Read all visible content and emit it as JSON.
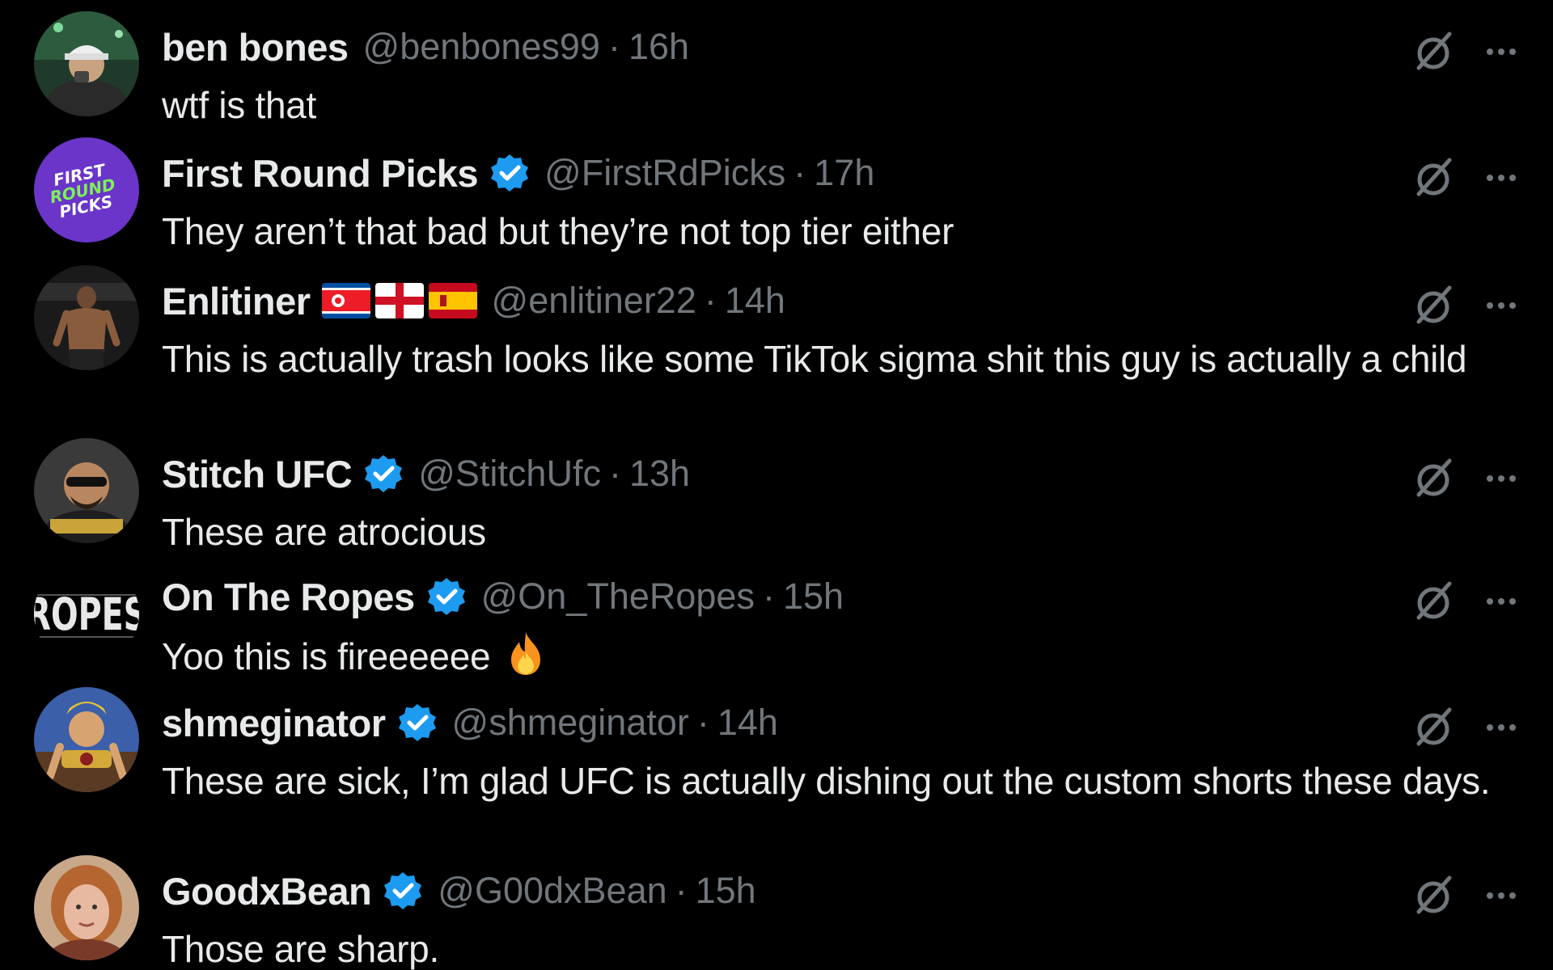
{
  "replies": [
    {
      "name": "ben bones",
      "handle": "@benbones99",
      "separator": "·",
      "time": "16h",
      "verified": false,
      "text": "wtf is that",
      "avatar_icon": "profile-photo-man-cap"
    },
    {
      "name": "First Round Picks",
      "handle": "@FirstRdPicks",
      "separator": "·",
      "time": "17h",
      "verified": true,
      "text": "They aren’t that bad but they’re not top tier either",
      "avatar_icon": "first-round-picks-logo",
      "avatar_logo_text": [
        "FIRST",
        "ROUND",
        "PICKS"
      ]
    },
    {
      "name": "Enlitiner",
      "handle": "@enlitiner22",
      "separator": "·",
      "time": "14h",
      "verified": false,
      "text": "This is actually trash looks like some TikTok sigma shit this guy is actually a child",
      "avatar_icon": "profile-photo-fighter",
      "flags": [
        "north-korea-flag",
        "england-flag",
        "spain-flag"
      ]
    },
    {
      "name": "Stitch UFC",
      "handle": "@StitchUfc",
      "separator": "·",
      "time": "13h",
      "verified": true,
      "text": "These are atrocious",
      "avatar_icon": "profile-photo-man-sunglasses"
    },
    {
      "name": "On The Ropes",
      "handle": "@On_TheRopes",
      "separator": "·",
      "time": "15h",
      "verified": true,
      "text": "Yoo this is fireeeeee",
      "emoji": "fire-emoji",
      "avatar_icon": "on-the-ropes-logo",
      "avatar_logo_text": "ROPES"
    },
    {
      "name": "shmeginator",
      "handle": "@shmeginator",
      "separator": "·",
      "time": "14h",
      "verified": true,
      "text": "These are sick, I’m glad UFC is actually dishing out the custom shorts these days.",
      "avatar_icon": "profile-photo-cartoon-fighter"
    },
    {
      "name": "GoodxBean",
      "handle": "@G00dxBean",
      "separator": "·",
      "time": "15h",
      "verified": true,
      "text": "Those are sharp.",
      "avatar_icon": "profile-photo-woman"
    }
  ],
  "colors": {
    "background": "#000000",
    "text_primary": "#e7e9ea",
    "text_secondary": "#71767b",
    "verified_blue": "#1d9bf0"
  }
}
